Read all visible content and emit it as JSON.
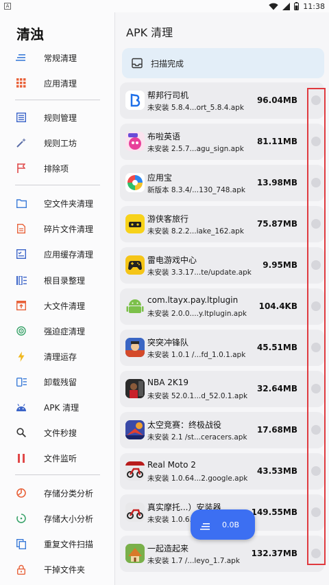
{
  "status_bar": {
    "time": "11:38",
    "app_badge": "A"
  },
  "drawer": {
    "title": "清浊",
    "items": [
      {
        "label": "常规清理",
        "icon": "lines-icon",
        "color": "#3b7bd8"
      },
      {
        "label": "应用清理",
        "icon": "grid-icon",
        "color": "#e8623a"
      },
      {
        "label": "规则管理",
        "icon": "list-box-icon",
        "color": "#3b64c8"
      },
      {
        "label": "规则工坊",
        "icon": "magic-wand-icon",
        "color": "#5b6ea8"
      },
      {
        "label": "排除项",
        "icon": "flag-icon",
        "color": "#e04848"
      },
      {
        "label": "空文件夹清理",
        "icon": "folder-icon",
        "color": "#3b7bd8"
      },
      {
        "label": "碎片文件清理",
        "icon": "document-icon",
        "color": "#e8623a"
      },
      {
        "label": "应用缓存清理",
        "icon": "checklist-icon",
        "color": "#3b64c8"
      },
      {
        "label": "根目录整理",
        "icon": "columns-icon",
        "color": "#3b64c8"
      },
      {
        "label": "大文件清理",
        "icon": "box-upload-icon",
        "color": "#e8623a"
      },
      {
        "label": "强迫症清理",
        "icon": "target-icon",
        "color": "#3aa36a"
      },
      {
        "label": "清理运存",
        "icon": "lightning-icon",
        "color": "#f0b820"
      },
      {
        "label": "卸载残留",
        "icon": "app-list-icon",
        "color": "#3b7bd8"
      },
      {
        "label": "APK 清理",
        "icon": "android-icon",
        "color": "#3b64c8"
      },
      {
        "label": "文件秒搜",
        "icon": "search-icon",
        "color": "#333333"
      },
      {
        "label": "文件监听",
        "icon": "pause-icon",
        "color": "#e04848"
      },
      {
        "label": "存储分类分析",
        "icon": "pie-icon",
        "color": "#e8623a"
      },
      {
        "label": "存储大小分析",
        "icon": "progress-ring-icon",
        "color": "#3aa36a"
      },
      {
        "label": "重复文件扫描",
        "icon": "copy-icon",
        "color": "#3b7bd8"
      },
      {
        "label": "干掉文件夹",
        "icon": "lock-icon",
        "color": "#e8623a"
      }
    ]
  },
  "main": {
    "title": "APK 清理",
    "scan_status": "扫描完成",
    "apks": [
      {
        "name": "帮邦行司机",
        "sub": "未安装 5.8.4...ort_5.8.4.apk",
        "size": "96.04MB"
      },
      {
        "name": "布啦英语",
        "sub": "未安装 2.5.7...agu_sign.apk",
        "size": "81.11MB"
      },
      {
        "name": "应用宝",
        "sub": "新版本 8.3.4/...130_748.apk",
        "size": "13.98MB"
      },
      {
        "name": "游侠客旅行",
        "sub": "未安装 8.2.2...iake_162.apk",
        "size": "75.87MB"
      },
      {
        "name": "雷电游戏中心",
        "sub": "未安装 3.3.17...te/update.apk",
        "size": "9.95MB"
      },
      {
        "name": "com.ltayx.pay.ltplugin",
        "sub": "未安装 2.0.0....y.ltplugin.apk",
        "size": "104.4KB"
      },
      {
        "name": "突突冲锋队",
        "sub": "未安装 1.0.1 /...fd_1.0.1.apk",
        "size": "45.51MB"
      },
      {
        "name": "NBA 2K19",
        "sub": "未安装 52.0.1...d_52.0.1.apk",
        "size": "32.64MB"
      },
      {
        "name": "太空竞赛：终极战役",
        "sub": "未安装 2.1 /st...ceracers.apk",
        "size": "17.68MB"
      },
      {
        "name": "Real Moto 2",
        "sub": "未安装 1.0.64...2.google.apk",
        "size": "43.53MB"
      },
      {
        "name": "真实摩托...）安装器",
        "sub": "未安装 1.0.6...",
        "size": "149.55MB"
      },
      {
        "name": "一起造起来",
        "sub": "未安装 1.7 /...leyo_1.7.apk",
        "size": "132.37MB"
      }
    ],
    "fab_label": "0.0B"
  }
}
